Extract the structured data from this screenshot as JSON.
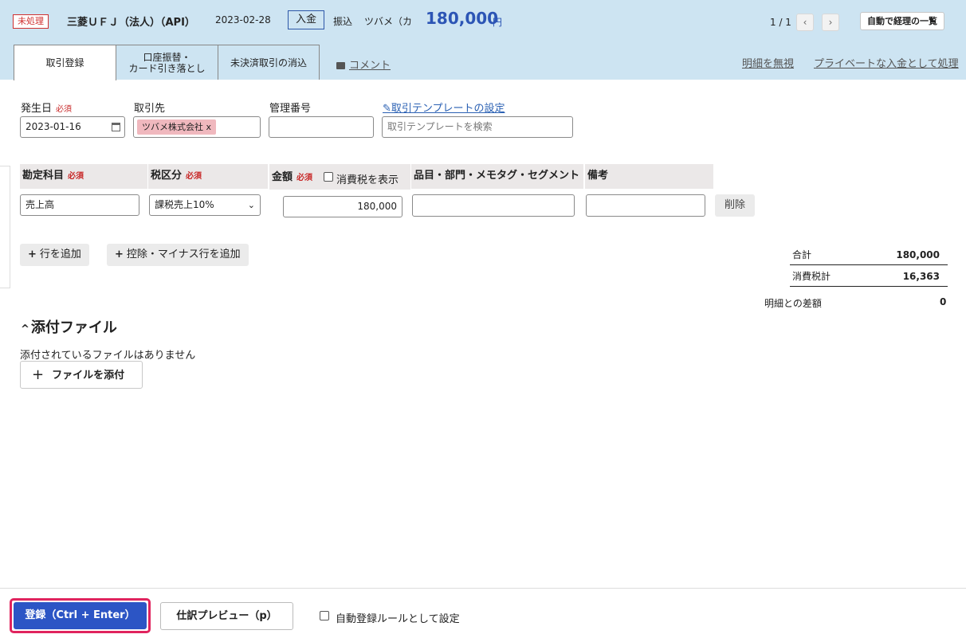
{
  "header": {
    "status": "未処理",
    "bank": "三菱ＵＦＪ（法人）（API）",
    "date": "2023-02-28",
    "type": "入金",
    "method": "振込",
    "counterparty": "ツバメ（カ",
    "amount": "180,000",
    "currency": "円",
    "pager": "1 / 1",
    "prev_icon": "chevron-left",
    "next_icon": "chevron-right",
    "auto_list_label": "自動で経理の一覧"
  },
  "tabs": [
    {
      "label": "取引登録"
    },
    {
      "label": "口座振替・\nカード引き落とし"
    },
    {
      "label": "未決済取引の消込"
    }
  ],
  "comment_label": "コメント",
  "ignore_label": "明細を無視",
  "private_label": "プライベートな入金として処理",
  "form": {
    "date_label": "発生日",
    "required": "必須",
    "date_value": "2023-01-16",
    "partner_label": "取引先",
    "partner_tag": "ツバメ株式会社",
    "partner_tag_remove": "x",
    "mgmt_label": "管理番号",
    "mgmt_value": "",
    "template_link": "取引テンプレートの設定",
    "template_placeholder": "取引テンプレートを検索"
  },
  "table": {
    "headers": {
      "account": "勘定科目",
      "tax": "税区分",
      "amount": "金額",
      "show_tax": "消費税を表示",
      "items": "品目・部門・メモタグ・セグメント",
      "note": "備考"
    },
    "row": {
      "account": "売上高",
      "tax": "課税売上10%",
      "amount": "180,000",
      "items": "",
      "note": ""
    },
    "delete_label": "削除",
    "add_row": "行を追加",
    "add_deduction": "控除・マイナス行を追加"
  },
  "summary": {
    "total_label": "合計",
    "total_value": "180,000",
    "tax_label": "消費税計",
    "tax_value": "16,363",
    "diff_label": "明細との差額",
    "diff_value": "0"
  },
  "attachments": {
    "title": "添付ファイル",
    "none": "添付されているファイルはありません",
    "add": "ファイルを添付"
  },
  "footer": {
    "submit": "登録（Ctrl + Enter）",
    "preview": "仕訳プレビュー（p）",
    "auto_rule": "自動登録ルールとして設定"
  }
}
